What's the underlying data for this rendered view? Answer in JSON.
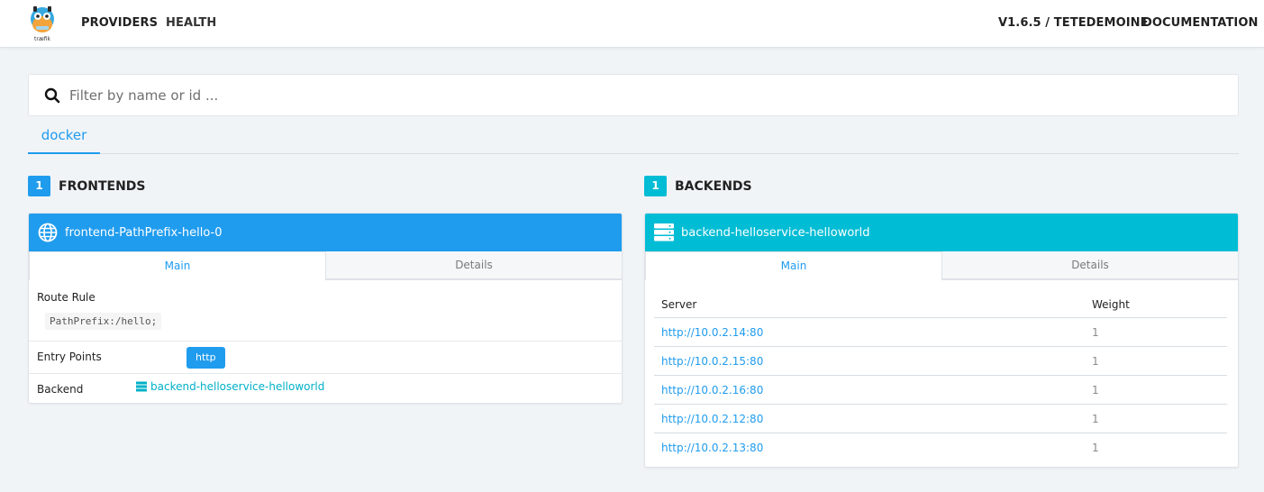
{
  "nav": {
    "logo_text": "træfik",
    "providers": "PROVIDERS",
    "health": "HEALTH",
    "version": "V1.6.5 / TETEDEMOINE",
    "documentation": "DOCUMENTATION"
  },
  "search": {
    "placeholder": "Filter by name or id ...",
    "value": ""
  },
  "provider_tabs": [
    {
      "label": "docker",
      "active": true
    }
  ],
  "frontends": {
    "count": "1",
    "title": "FRONTENDS",
    "color": "#209cee",
    "card": {
      "name": "frontend-PathPrefix-hello-0",
      "tabs": [
        "Main",
        "Details"
      ],
      "route_rule_label": "Route Rule",
      "route_rule_value": "PathPrefix:/hello;",
      "entry_points_label": "Entry Points",
      "entry_points": [
        "http"
      ],
      "backend_label": "Backend",
      "backend_value": "backend-helloservice-helloworld"
    }
  },
  "backends": {
    "count": "1",
    "title": "BACKENDS",
    "color": "#00bcd4",
    "card": {
      "name": "backend-helloservice-helloworld",
      "tabs": [
        "Main",
        "Details"
      ],
      "columns": [
        "Server",
        "Weight"
      ],
      "servers": [
        {
          "url": "http://10.0.2.14:80",
          "weight": "1"
        },
        {
          "url": "http://10.0.2.15:80",
          "weight": "1"
        },
        {
          "url": "http://10.0.2.16:80",
          "weight": "1"
        },
        {
          "url": "http://10.0.2.12:80",
          "weight": "1"
        },
        {
          "url": "http://10.0.2.13:80",
          "weight": "1"
        }
      ]
    }
  },
  "icons": {
    "search": "search-icon",
    "frontend": "globe-icon",
    "backend": "server-icon",
    "backend_link": "server-icon"
  }
}
